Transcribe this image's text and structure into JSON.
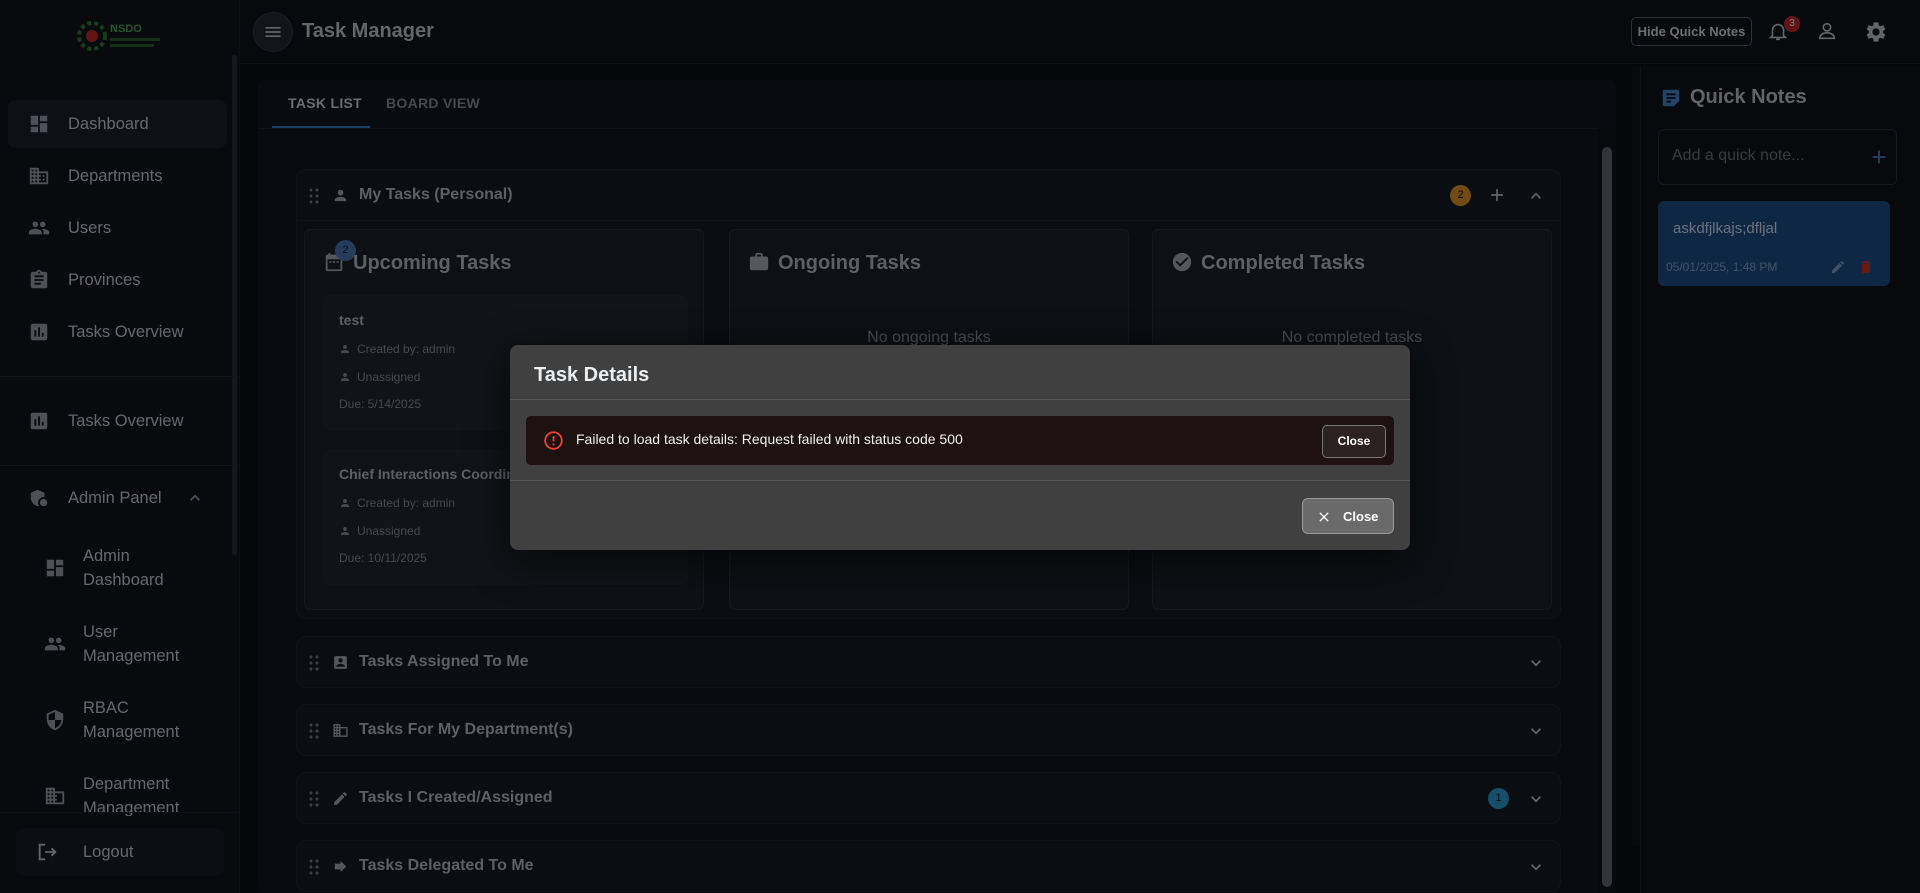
{
  "app": {
    "title": "Task Manager",
    "logo_text": "NSDO"
  },
  "header": {
    "hide_notes_label": "Hide Quick Notes",
    "notification_count": "3"
  },
  "sidebar": {
    "items": [
      {
        "label": "Dashboard",
        "icon": "dashboard-icon"
      },
      {
        "label": "Departments",
        "icon": "building-icon"
      },
      {
        "label": "Users",
        "icon": "users-icon"
      },
      {
        "label": "Provinces",
        "icon": "clipboard-icon"
      },
      {
        "label": "Tasks Overview",
        "icon": "chart-icon"
      },
      {
        "label": "Tasks Overview",
        "icon": "chart-icon"
      }
    ],
    "admin": {
      "label": "Admin Panel",
      "items": [
        {
          "line1": "Admin",
          "line2": "Dashboard"
        },
        {
          "line1": "User",
          "line2": "Management"
        },
        {
          "line1": "RBAC",
          "line2": "Management"
        },
        {
          "line1": "Department",
          "line2": "Management"
        }
      ]
    },
    "logout_label": "Logout"
  },
  "tabs": [
    {
      "label": "TASK LIST"
    },
    {
      "label": "BOARD VIEW"
    }
  ],
  "sections": [
    {
      "title": "My Tasks (Personal)",
      "count": "2"
    },
    {
      "title": "Tasks Assigned To Me"
    },
    {
      "title": "Tasks For My Department(s)"
    },
    {
      "title": "Tasks I Created/Assigned",
      "count": "1"
    },
    {
      "title": "Tasks Delegated To Me"
    }
  ],
  "columns": [
    {
      "title": "Upcoming Tasks",
      "badge": "2"
    },
    {
      "title": "Ongoing Tasks",
      "empty": "No ongoing tasks"
    },
    {
      "title": "Completed Tasks",
      "empty": "No completed tasks"
    }
  ],
  "tasks": [
    {
      "title": "test",
      "created_by": "Created by: admin",
      "assignee": "Unassigned",
      "due": "Due: 5/14/2025"
    },
    {
      "title": "Chief Interactions Coordinator",
      "created_by": "Created by: admin",
      "assignee": "Unassigned",
      "due": "Due: 10/11/2025"
    }
  ],
  "quick_notes": {
    "title": "Quick Notes",
    "placeholder": "Add a quick note...",
    "notes": [
      {
        "text": "askdfjlkajs;dfljal",
        "date": "05/01/2025, 1:48 PM"
      }
    ]
  },
  "dialog": {
    "title": "Task Details",
    "error": "Failed to load task details: Request failed with status code 500",
    "alert_close": "Close",
    "close_label": "Close"
  },
  "colors": {
    "accent": "#3d83c6",
    "error": "#f44336",
    "note_bg": "#1d4e8a",
    "warning_badge": "#e0962a",
    "info_badge": "#2a9ed8"
  }
}
